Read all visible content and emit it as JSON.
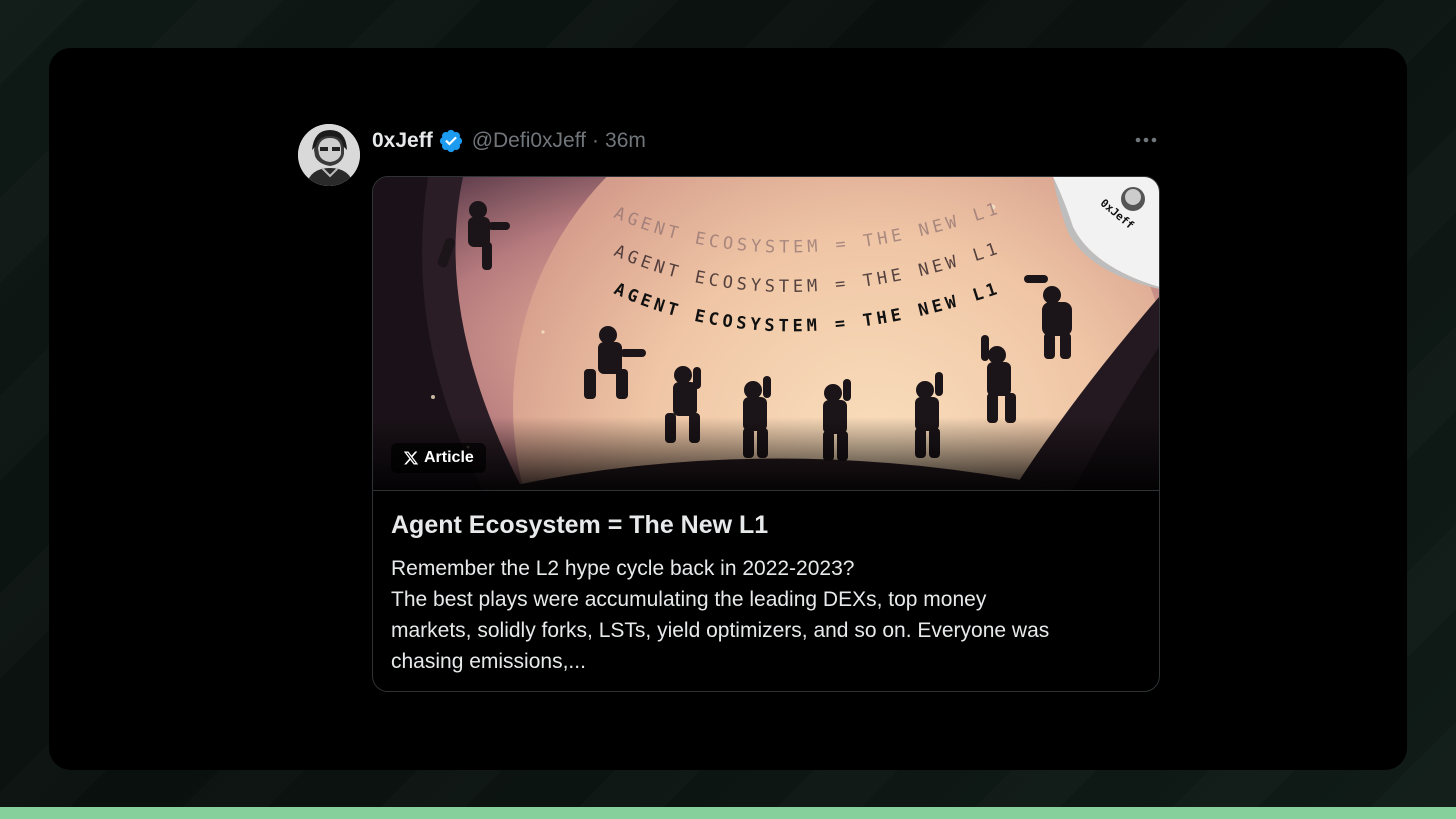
{
  "tweet": {
    "display_name": "0xJeff",
    "handle": "@Defi0xJeff",
    "separator": "·",
    "time": "36m",
    "avatar_icon": "avatar-portrait",
    "verified_icon": "verified-badge-icon",
    "more_icon": "more-dots-icon",
    "accent_color": "#1d9bf0"
  },
  "article": {
    "badge_label": "Article",
    "badge_icon": "x-logo-icon",
    "title": "Agent Ecosystem = The New L1",
    "body_lines": [
      "Remember the L2 hype cycle back in 2022-2023?",
      "The best plays were accumulating the leading DEXs, top money",
      "markets, solidly forks, LSTs, yield optimizers, and so on. Everyone was",
      "chasing emissions,..."
    ],
    "hero": {
      "text_lines": [
        "AGENT ECOSYSTEM = THE NEW L1",
        "AGENT ECOSYSTEM = THE NEW L1",
        "AGENT ECOSYSTEM = THE NEW L1"
      ],
      "sticker_text": "0xJeff"
    }
  }
}
